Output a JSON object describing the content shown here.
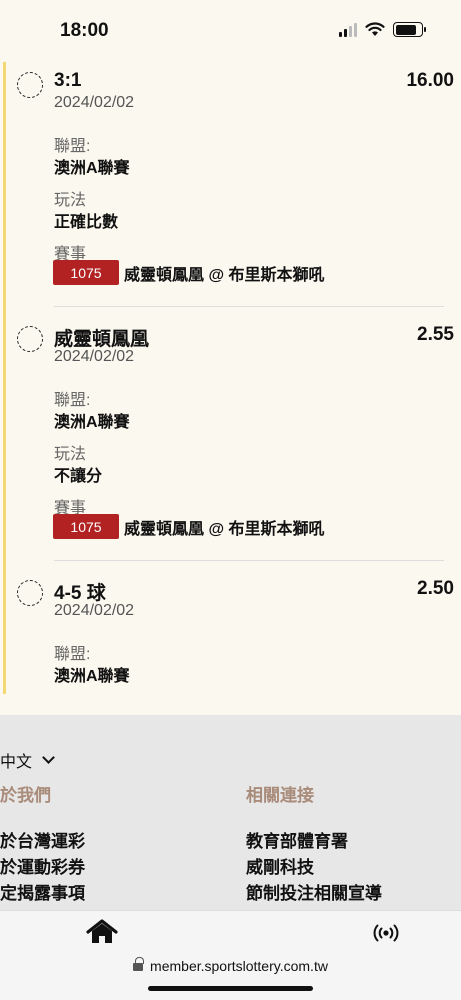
{
  "status": {
    "time": "18:00"
  },
  "bets": [
    {
      "title": "3:1",
      "odds": "16.00",
      "date": "2024/02/02",
      "league_label": "聯盟:",
      "league": "澳洲A聯賽",
      "play_label": "玩法",
      "play": "正確比數",
      "match_label": "賽事",
      "match_code": "1075",
      "match_name": "威靈頓鳳凰 @ 布里斯本獅吼"
    },
    {
      "title": "威靈頓鳳凰",
      "odds": "2.55",
      "date": "2024/02/02",
      "league_label": "聯盟:",
      "league": "澳洲A聯賽",
      "play_label": "玩法",
      "play": "不讓分",
      "match_label": "賽事",
      "match_code": "1075",
      "match_name": "威靈頓鳳凰 @ 布里斯本獅吼"
    },
    {
      "title": "4-5 球",
      "odds": "2.50",
      "date": "2024/02/02",
      "league_label": "聯盟:",
      "league": "澳洲A聯賽"
    }
  ],
  "footer": {
    "language": "中文",
    "about_heading": "於我們",
    "about_links": [
      "於台灣運彩",
      "於運動彩券",
      "定揭露事項"
    ],
    "related_heading": "相關連接",
    "related_links": [
      "教育部體育署",
      "威剛科技",
      "節制投注相關宣導"
    ]
  },
  "tabbar": {
    "icons": [
      "home-icon",
      "live-broadcast-icon"
    ]
  },
  "browser": {
    "url": "member.sportslottery.com.tw"
  }
}
